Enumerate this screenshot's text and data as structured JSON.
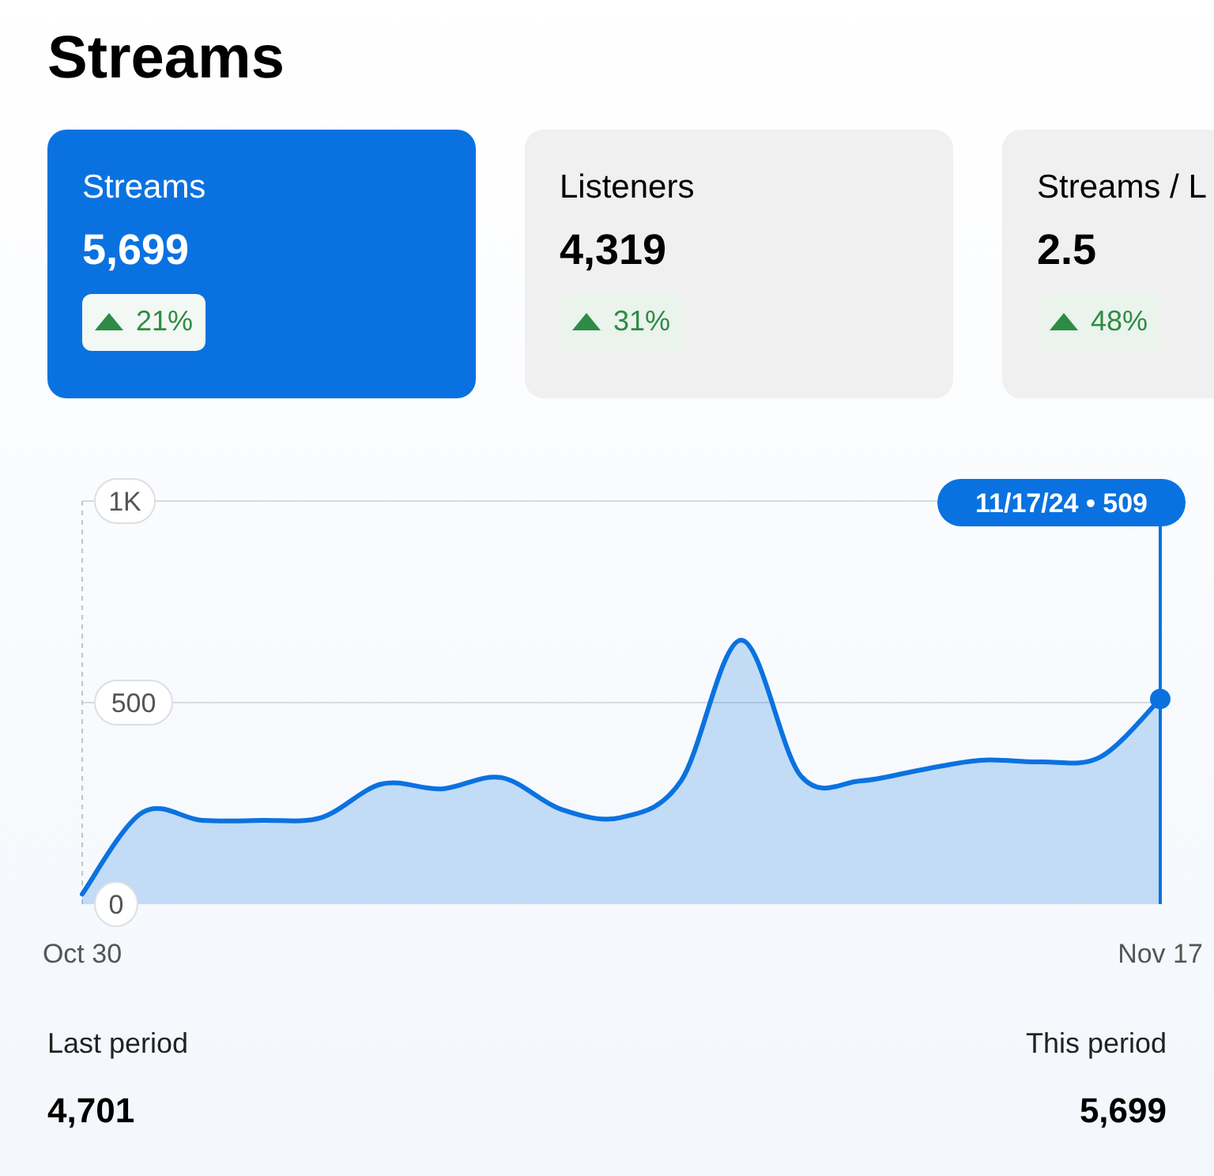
{
  "title": "Streams",
  "metric_cards": [
    {
      "label": "Streams",
      "value": "5,699",
      "change": "21%",
      "selected": true
    },
    {
      "label": "Listeners",
      "value": "4,319",
      "change": "31%",
      "selected": false
    },
    {
      "label": "Streams / L",
      "value": "2.5",
      "change": "48%",
      "selected": false
    }
  ],
  "chart": {
    "tooltip": "11/17/24 • 509",
    "chart_data": {
      "type": "area",
      "categories": [
        "Oct 30",
        null,
        null,
        null,
        null,
        null,
        null,
        null,
        null,
        null,
        null,
        null,
        null,
        null,
        null,
        null,
        null,
        null,
        "Nov 17"
      ],
      "yticks": [
        0,
        500,
        {
          "value": 1000,
          "label": "1K"
        }
      ],
      "ylim": [
        0,
        1000
      ],
      "series": [
        {
          "color": "#0a72e0",
          "values": [
            25,
            227,
            208,
            208,
            215,
            298,
            286,
            314,
            235,
            215,
            306,
            655,
            318,
            306,
            333,
            357,
            353,
            365,
            509
          ]
        }
      ]
    }
  },
  "summary": [
    {
      "label": "Last period",
      "value": "4,701"
    },
    {
      "label": "This period",
      "value": "5,699"
    }
  ]
}
